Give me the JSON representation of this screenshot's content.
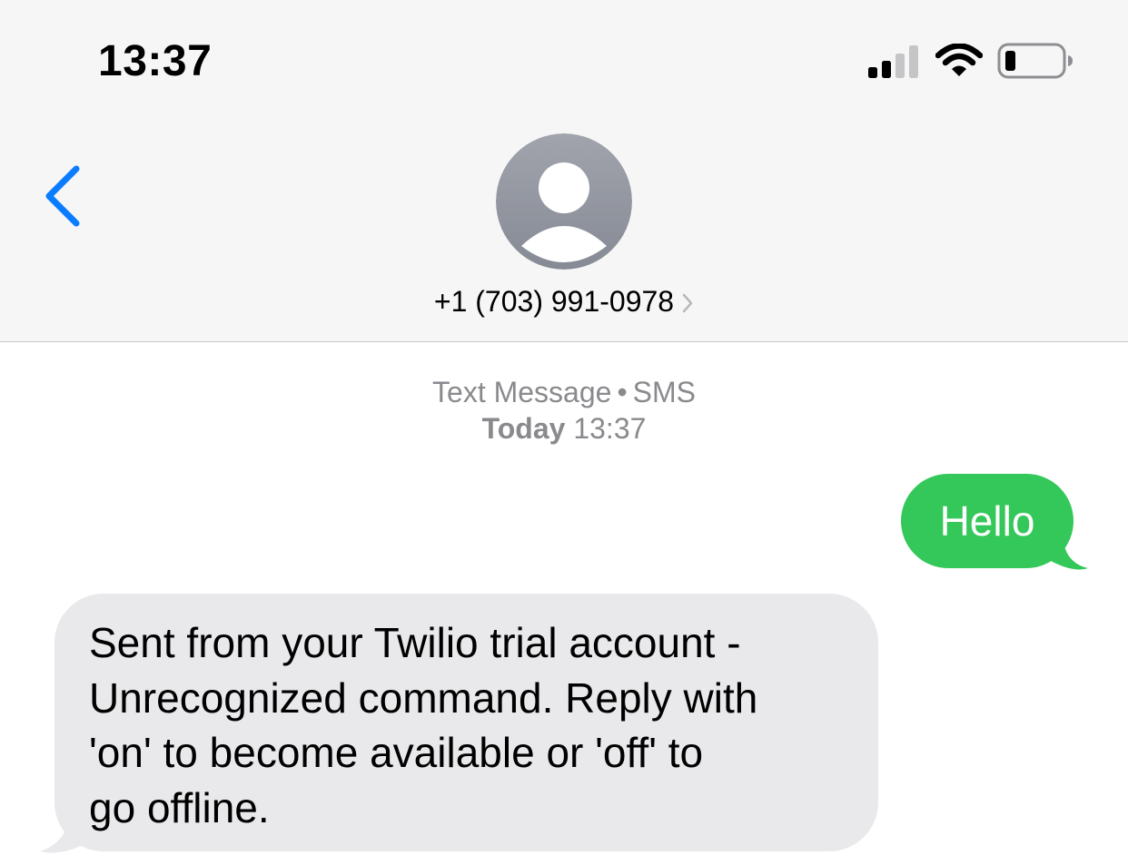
{
  "status_bar": {
    "time": "13:37",
    "signal_icon": "cellular-signal-icon",
    "wifi_icon": "wifi-icon",
    "battery_icon": "battery-low-icon"
  },
  "header": {
    "back_icon": "chevron-left-icon",
    "avatar_icon": "person-avatar-icon",
    "contact": "+1 (703) 991-0978",
    "contact_chevron_icon": "chevron-right-icon"
  },
  "conversation": {
    "service_label": "Text Message",
    "service_separator": "•",
    "service_type": "SMS",
    "day_label": "Today",
    "time_label": "13:37",
    "messages": [
      {
        "direction": "outgoing",
        "text": "Hello"
      },
      {
        "direction": "incoming",
        "text": "Sent from your Twilio trial account -\nUnrecognized command. Reply with\n'on' to become available or 'off' to\ngo offline."
      }
    ]
  },
  "colors": {
    "accent_blue": "#0a7cff",
    "sms_green": "#34c759",
    "incoming_gray": "#e9e9eb",
    "meta_gray": "#8a8a8e",
    "header_bg": "#f6f6f6"
  }
}
